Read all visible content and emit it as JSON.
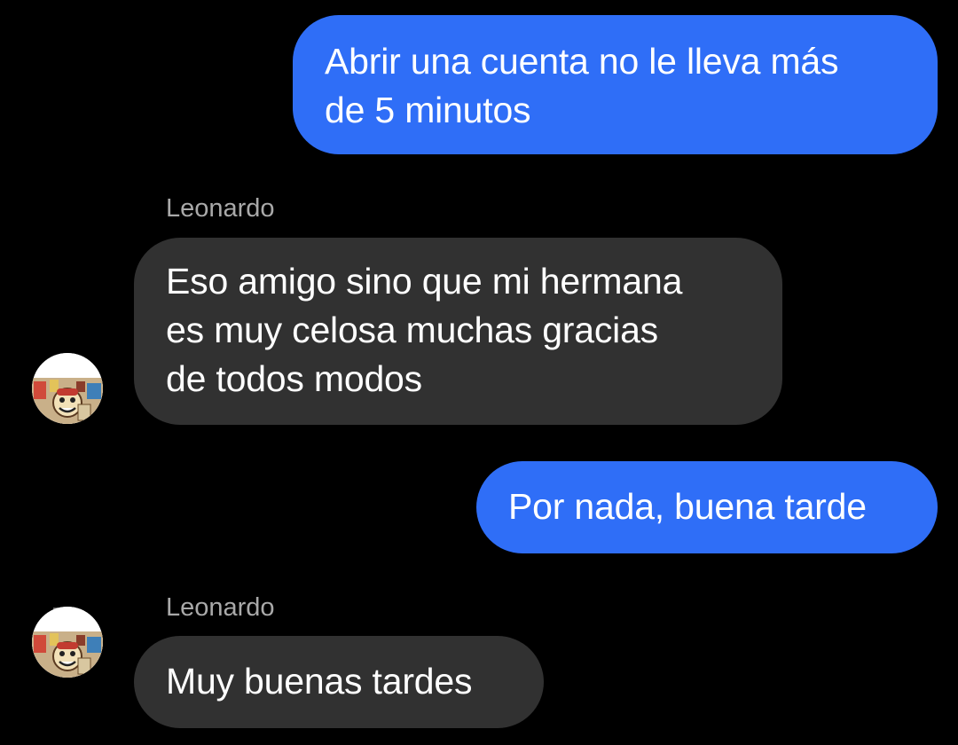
{
  "messages": [
    {
      "direction": "outgoing",
      "text": "Abrir una cuenta no le lleva más\nde 5 minutos"
    },
    {
      "direction": "incoming",
      "sender": "Leonardo",
      "text": "Eso amigo sino que mi hermana\nes muy celosa muchas gracias\nde todos modos"
    },
    {
      "direction": "outgoing",
      "text": "Por nada, buena tarde"
    },
    {
      "direction": "incoming",
      "sender": "Leonardo",
      "text": "Muy buenas tardes"
    }
  ],
  "colors": {
    "background": "#000000",
    "outgoing_bubble": "#2f6ef7",
    "incoming_bubble": "#313131",
    "sender_name": "#a9a9a9",
    "text": "#ffffff"
  }
}
